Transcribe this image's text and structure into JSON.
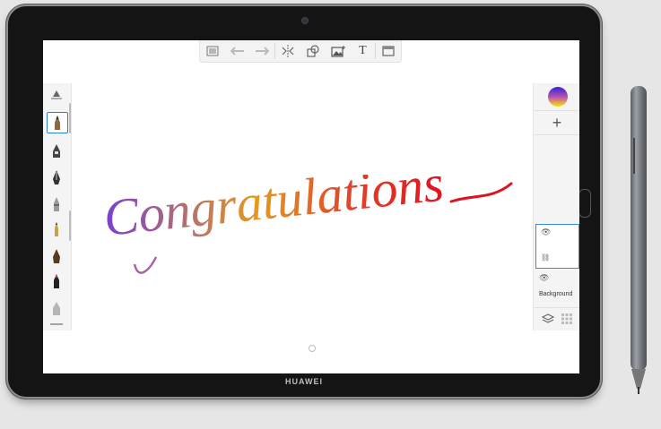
{
  "device": {
    "brand": "HUAWEI"
  },
  "toolbar": {
    "items": [
      {
        "name": "list-icon"
      },
      {
        "name": "undo-icon"
      },
      {
        "name": "redo-icon"
      },
      {
        "name": "symmetry-icon"
      },
      {
        "name": "shapes-icon"
      },
      {
        "name": "image-icon"
      },
      {
        "name": "text-tool",
        "label": "T"
      },
      {
        "name": "fullscreen-icon"
      }
    ]
  },
  "canvas": {
    "artwork_text": "Congratulations"
  },
  "layers": {
    "items": [
      {
        "label": ""
      },
      {
        "label": "Background"
      }
    ],
    "add_label": "+"
  },
  "colors": {
    "accent": "#2f7fd8",
    "gradient": [
      "#7a3fd0",
      "#e59a1e",
      "#e52a2a"
    ]
  }
}
